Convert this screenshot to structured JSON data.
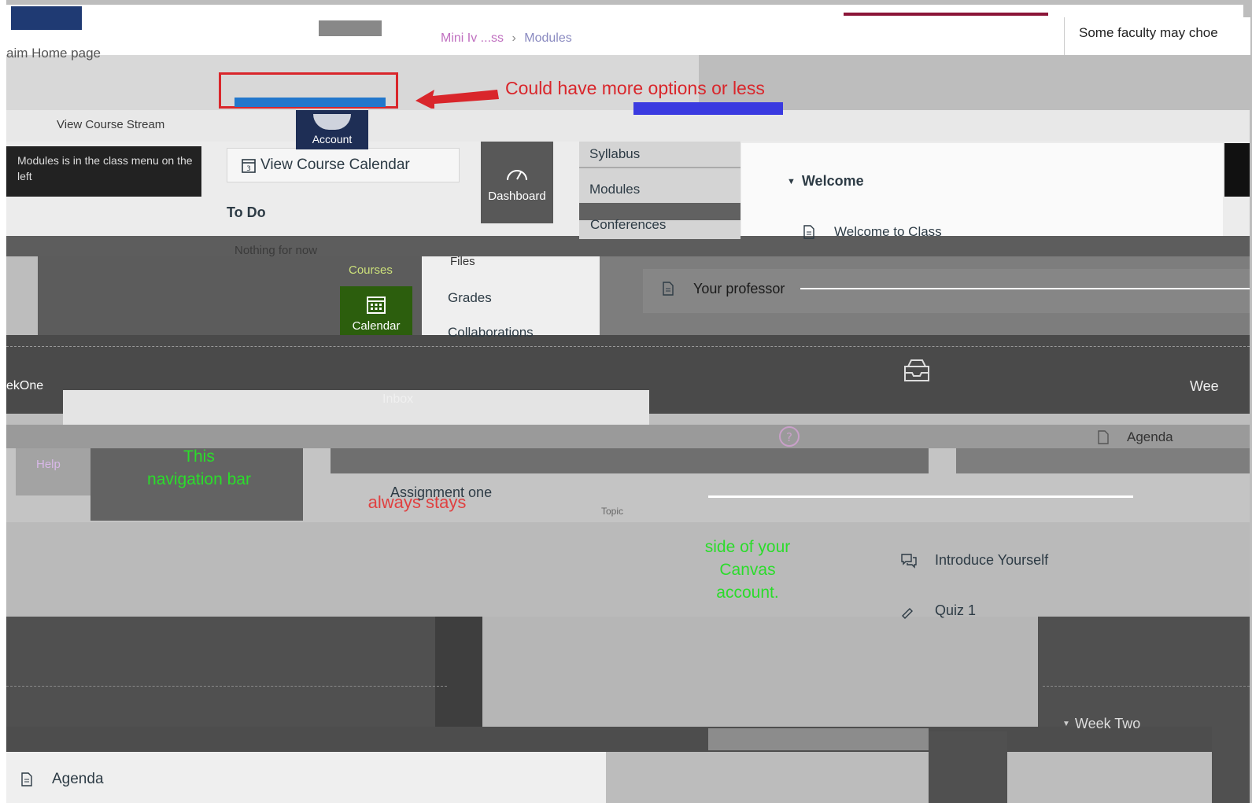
{
  "breadcrumb": {
    "course": "Mini Iv ...ss",
    "current": "Modules"
  },
  "callout_top": "Some faculty may choe",
  "header_fragment": "aim Home page",
  "annotations": {
    "more_options": "Could have more options or less",
    "nav_bar": [
      "This",
      "navigation bar",
      "always stays",
      "side of your",
      "Canvas",
      "account."
    ]
  },
  "sidebar": {
    "view_stream": "View Course Stream",
    "view_calendar": "View Course Calendar",
    "todo_title": "To Do",
    "todo_empty": "Nothing for now",
    "left_note": "Modules is in the class menu on the left",
    "week_one": "ekOne"
  },
  "global_nav": {
    "account": "Account",
    "dashboard": "Dashboard",
    "courses": "Courses",
    "calendar": "Calendar",
    "inbox": "Inbox",
    "help": "Help"
  },
  "course_menu": {
    "syllabus": "Syllabus",
    "modules": "Modules",
    "conferences": "Conferences",
    "files": "Files",
    "grades": "Grades",
    "collaborations": "Collaborations"
  },
  "modules": {
    "welcome": "Welcome",
    "welcome_to_class": "Welcome to Class",
    "your_professor": "Your professor",
    "week_one": "Wee",
    "agenda": "Agenda",
    "assignment_one": "Assignment one",
    "introduce_yourself": "Introduce Yourself",
    "quiz1": "Quiz 1",
    "week_two": "Week Two",
    "topic": "Topic"
  },
  "colors": {
    "calendar_active": "#2c5e0d",
    "annotation_red": "#d9262b",
    "annotation_green": "#2bdc2b",
    "dark_bar": "#3e3e3e"
  }
}
